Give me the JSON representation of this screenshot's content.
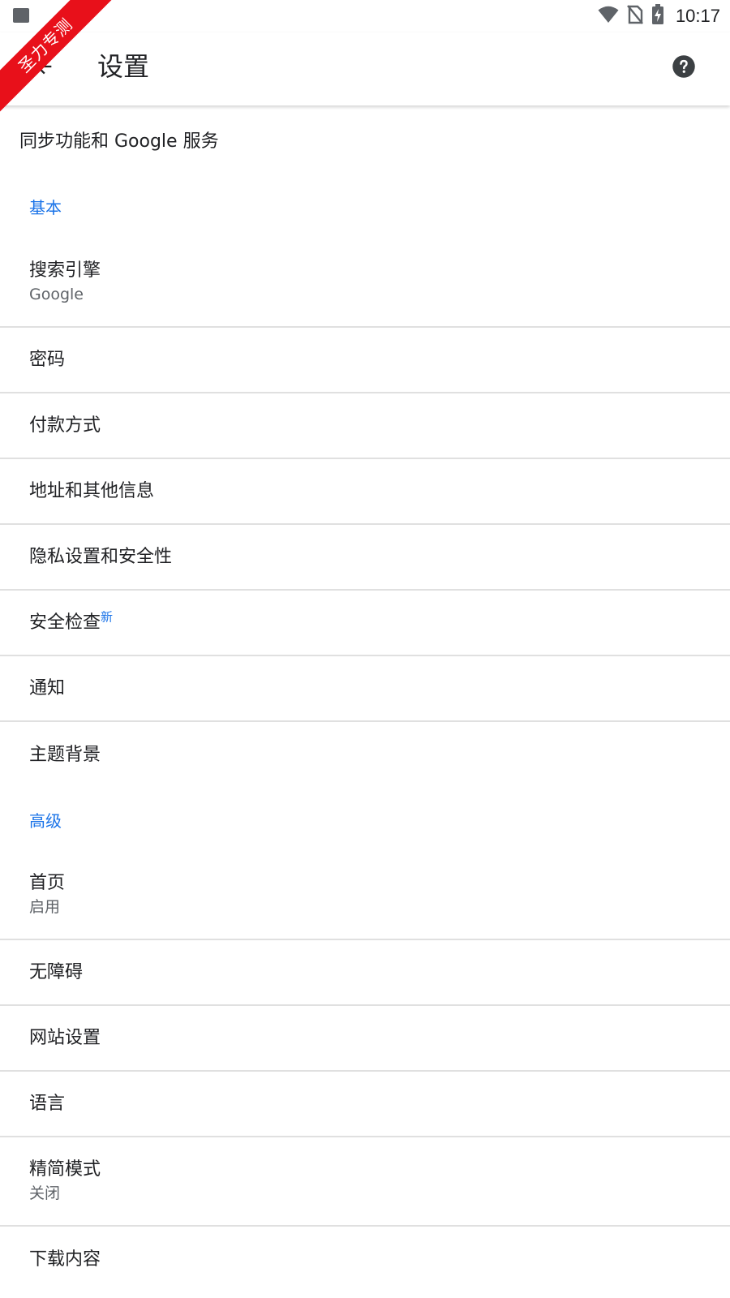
{
  "status_bar": {
    "time": "10:17"
  },
  "ribbon": {
    "text": "圣力专测"
  },
  "app_bar": {
    "title": "设置"
  },
  "sync": {
    "label": "同步功能和 Google 服务"
  },
  "sections": {
    "basic": {
      "header": "基本",
      "items": [
        {
          "title": "搜索引擎",
          "subtitle": "Google"
        },
        {
          "title": "密码"
        },
        {
          "title": "付款方式"
        },
        {
          "title": "地址和其他信息"
        },
        {
          "title": "隐私设置和安全性"
        },
        {
          "title": "安全检查",
          "badge": "新"
        },
        {
          "title": "通知"
        },
        {
          "title": "主题背景"
        }
      ]
    },
    "advanced": {
      "header": "高级",
      "items": [
        {
          "title": "首页",
          "subtitle": "启用"
        },
        {
          "title": "无障碍"
        },
        {
          "title": "网站设置"
        },
        {
          "title": "语言"
        },
        {
          "title": "精简模式",
          "subtitle": "关闭"
        },
        {
          "title": "下载内容"
        }
      ]
    }
  },
  "colors": {
    "accent": "#1a73e8",
    "ribbon": "#e8101a",
    "divider": "#e0e0e0"
  },
  "icons": {
    "back": "arrow-back-icon",
    "help": "help-icon",
    "wifi": "wifi-icon",
    "no_sim": "no-sim-icon",
    "battery": "battery-charging-icon"
  }
}
